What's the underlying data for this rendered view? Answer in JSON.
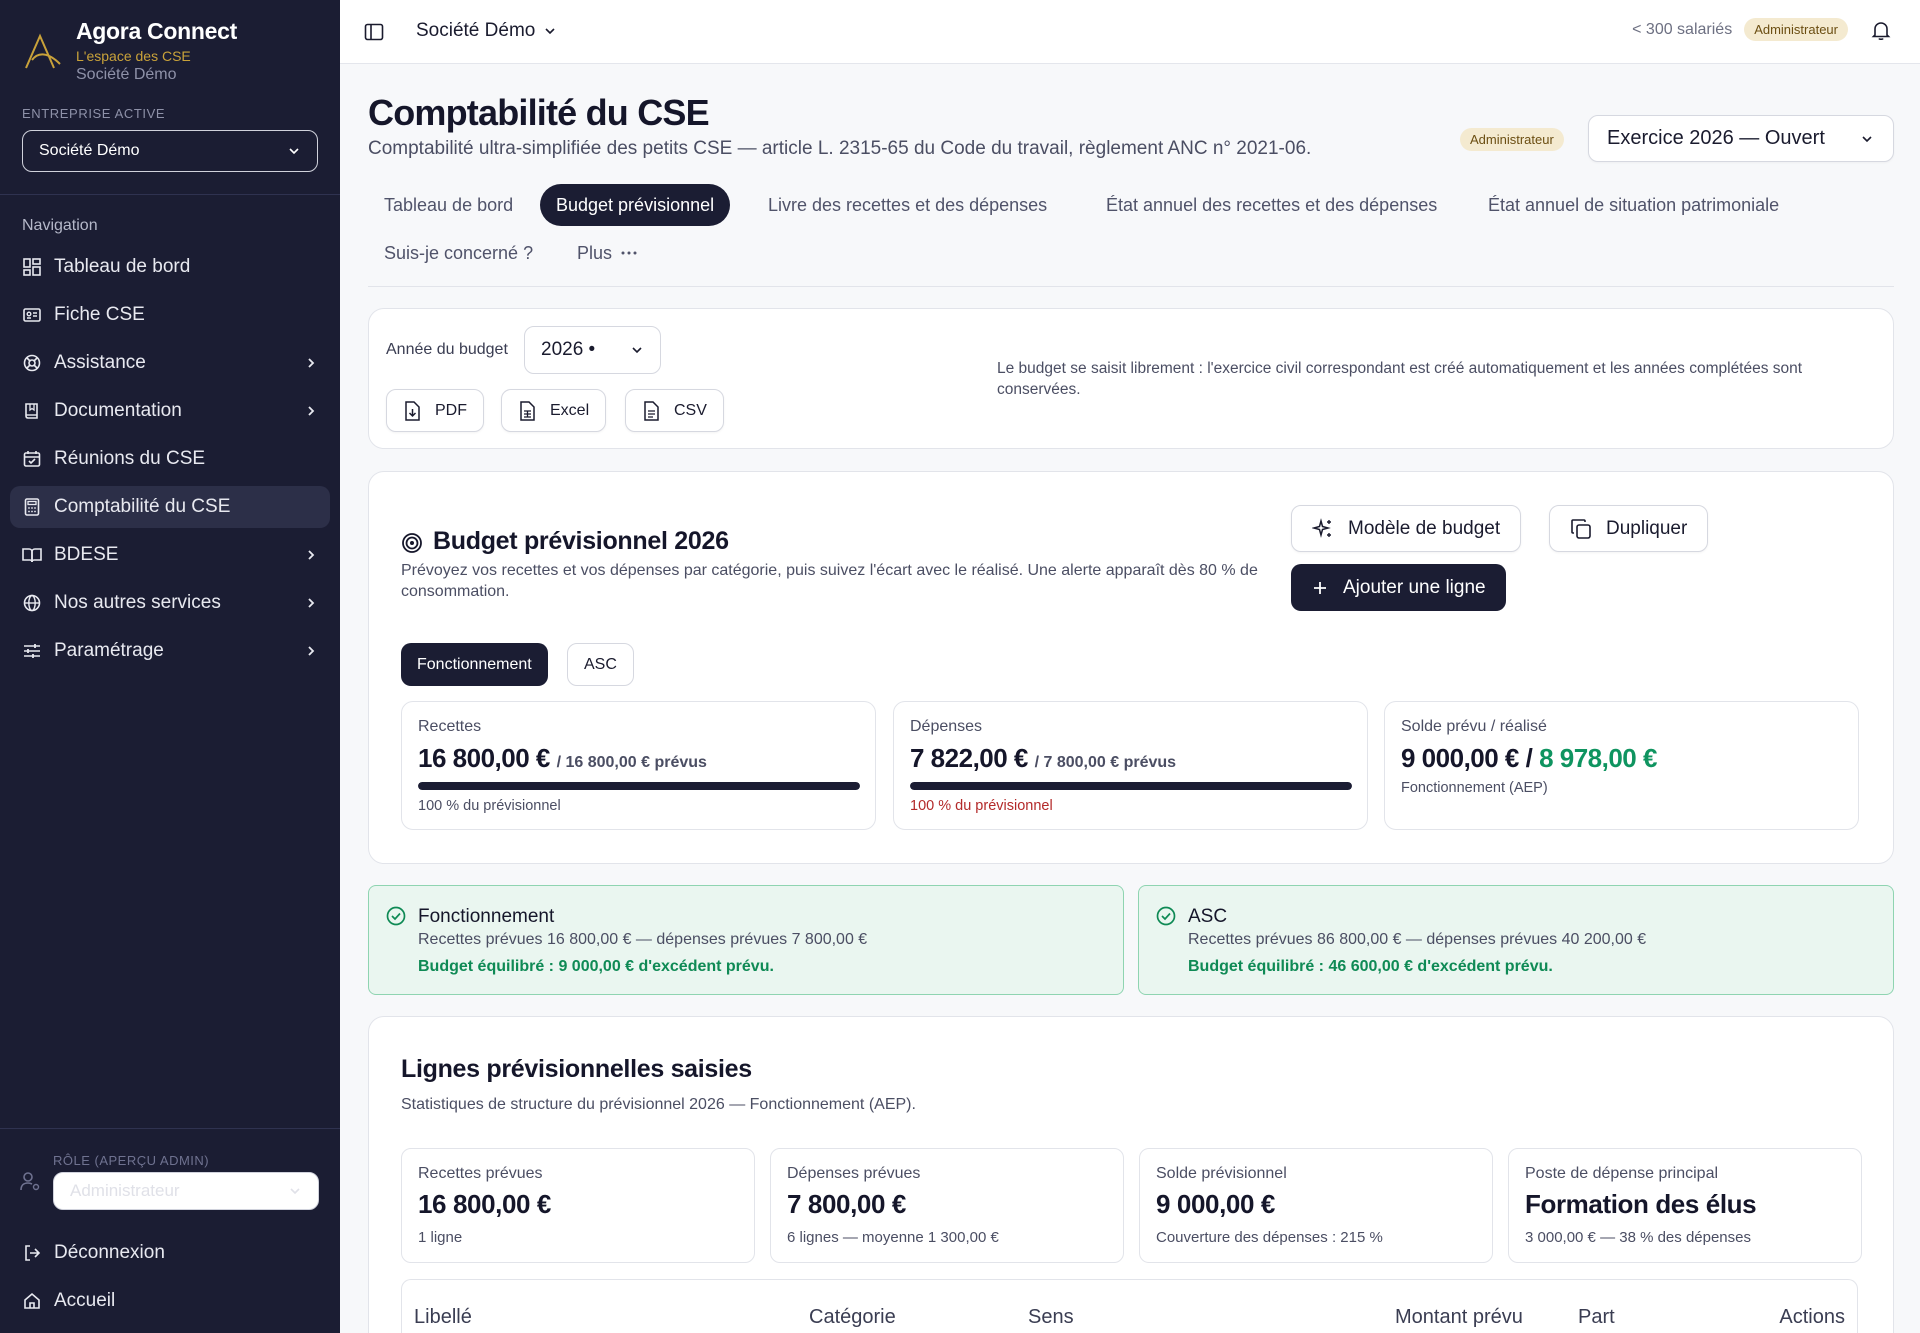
{
  "brand": {
    "name": "Agora Connect",
    "tagline": "L'espace des CSE",
    "company": "Société Démo"
  },
  "sidebar": {
    "enterprise_label": "ENTREPRISE ACTIVE",
    "enterprise_value": "Société Démo",
    "nav_label": "Navigation",
    "items": [
      {
        "label": "Tableau de bord",
        "icon": "dashboard-icon",
        "chevron": false
      },
      {
        "label": "Fiche CSE",
        "icon": "id-card-icon",
        "chevron": false
      },
      {
        "label": "Assistance",
        "icon": "lifebuoy-icon",
        "chevron": true
      },
      {
        "label": "Documentation",
        "icon": "book-icon",
        "chevron": true
      },
      {
        "label": "Réunions du CSE",
        "icon": "calendar-check-icon",
        "chevron": false
      },
      {
        "label": "Comptabilité du CSE",
        "icon": "calculator-icon",
        "chevron": false,
        "active": true
      },
      {
        "label": "BDESE",
        "icon": "open-book-icon",
        "chevron": true
      },
      {
        "label": "Nos autres services",
        "icon": "globe-icon",
        "chevron": true
      },
      {
        "label": "Paramétrage",
        "icon": "sliders-icon",
        "chevron": true
      }
    ],
    "role_label": "RÔLE (APERÇU ADMIN)",
    "role_value": "Administrateur",
    "logout": "Déconnexion",
    "home": "Accueil"
  },
  "topbar": {
    "company": "Société Démo",
    "employees": "< 300 salariés",
    "role_badge": "Administrateur"
  },
  "page": {
    "title": "Comptabilité du CSE",
    "subtitle": "Comptabilité ultra-simplifiée des petits CSE — article L. 2315-65 du Code du travail, règlement ANC n° 2021-06.",
    "role_badge": "Administrateur",
    "exercise": "Exercice 2026 — Ouvert"
  },
  "tabs": [
    {
      "label": "Tableau de bord"
    },
    {
      "label": "Budget prévisionnel",
      "active": true
    },
    {
      "label": "Livre des recettes et des dépenses"
    },
    {
      "label": "État annuel des recettes et des dépenses"
    },
    {
      "label": "État annuel de situation patrimoniale"
    },
    {
      "label": "Suis-je concerné ?"
    },
    {
      "label": "Plus"
    }
  ],
  "year_card": {
    "label": "Année du budget",
    "value": "2026 •",
    "pdf": "PDF",
    "excel": "Excel",
    "csv": "CSV",
    "note": "Le budget se saisit librement : l'exercice civil correspondant est créé automatiquement et les années complétées sont conservées."
  },
  "budget": {
    "title": "Budget prévisionnel 2026",
    "description": "Prévoyez vos recettes et vos dépenses par catégorie, puis suivez l'écart avec le réalisé. Une alerte apparaît dès 80 % de consommation.",
    "model_button": "Modèle de budget",
    "duplicate_button": "Dupliquer",
    "add_button": "Ajouter une ligne",
    "segments": [
      "Fonctionnement",
      "ASC"
    ],
    "kpis": [
      {
        "label": "Recettes",
        "value": "16 800,00 €",
        "planned": "/ 16 800,00 € prévus",
        "progress": 1.0,
        "foot": "100 % du prévisionnel"
      },
      {
        "label": "Dépenses",
        "value": "7 822,00 €",
        "planned": "/ 7 800,00 € prévus",
        "progress": 1.0,
        "foot": "100 % du prévisionnel"
      },
      {
        "label": "Solde prévu / réalisé",
        "value": "9 000,00 €",
        "separator": " / ",
        "realised": "8 978,00 €",
        "foot": "Fonctionnement (AEP)"
      }
    ]
  },
  "status": [
    {
      "title": "Fonctionnement",
      "line": "Recettes prévues 16 800,00 € — dépenses prévues 7 800,00 €",
      "ok": "Budget équilibré : 9 000,00 € d'excédent prévu."
    },
    {
      "title": "ASC",
      "line": "Recettes prévues 86 800,00 € — dépenses prévues 40 200,00 €",
      "ok": "Budget équilibré : 46 600,00 € d'excédent prévu."
    }
  ],
  "lines": {
    "title": "Lignes prévisionnelles saisies",
    "subtitle": "Statistiques de structure du prévisionnel 2026 — Fonctionnement (AEP).",
    "stats": [
      {
        "label": "Recettes prévues",
        "value": "16 800,00 €",
        "foot": "1 ligne"
      },
      {
        "label": "Dépenses prévues",
        "value": "7 800,00 €",
        "foot": "6 lignes — moyenne 1 300,00 €"
      },
      {
        "label": "Solde prévisionnel",
        "value": "9 000,00 €",
        "foot": "Couverture des dépenses : 215 %"
      },
      {
        "label": "Poste de dépense principal",
        "value": "Formation des élus",
        "foot": "3 000,00 € — 38 % des dépenses"
      }
    ],
    "columns": [
      "Libellé",
      "Catégorie",
      "Sens",
      "Montant prévu",
      "Part",
      "Actions"
    ]
  },
  "colors": {
    "sidebar": "#1b1d33",
    "accent_green": "#0f9460",
    "alert_red": "#b32a2a",
    "badge_bg": "#f4ead0"
  }
}
